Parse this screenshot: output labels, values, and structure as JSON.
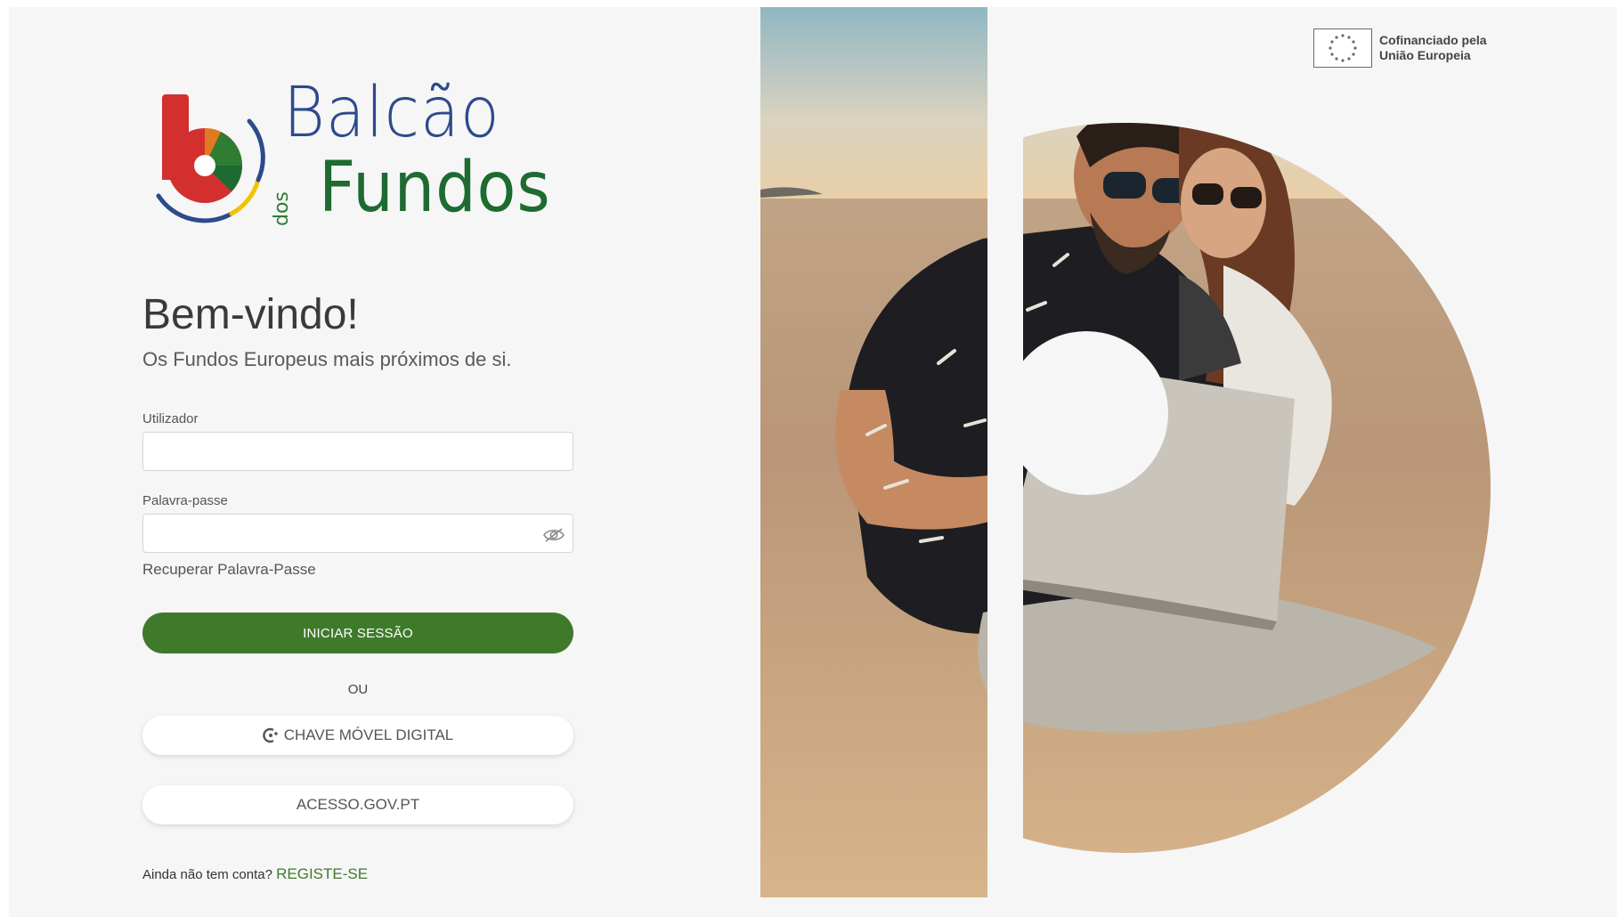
{
  "brand": {
    "name_line1": "Balcão",
    "name_small": "dos",
    "name_line2": "Fundos",
    "colors": {
      "blue": "#2d4a8c",
      "green": "#1e6b31",
      "red": "#d32f2f",
      "yellow": "#f2c200"
    }
  },
  "welcome": {
    "title": "Bem-vindo!",
    "subtitle": "Os Fundos Europeus mais próximos de si."
  },
  "login_form": {
    "username_label": "Utilizador",
    "username_value": "",
    "password_label": "Palavra-passe",
    "password_value": "",
    "password_toggle_icon": "eye-hidden-icon",
    "recover_link": "Recuperar Palavra-Passe",
    "submit_label": "INICIAR SESSÃO",
    "submit_color": "#3f7a2b",
    "or_text": "OU",
    "cmd_icon": "chave-movel-digital-icon",
    "cmd_label": "CHAVE MÓVEL DIGITAL",
    "gov_label": "ACESSO.GOV.PT",
    "register_prompt": "Ainda não tem conta?",
    "register_link": "REGISTE-SE"
  },
  "eu_badge": {
    "line1": "Cofinanciado pela",
    "line2": "União Europeia",
    "icon": "eu-flag-icon"
  },
  "hero": {
    "image": "couple-on-beach-with-laptop-in-b-shape"
  }
}
